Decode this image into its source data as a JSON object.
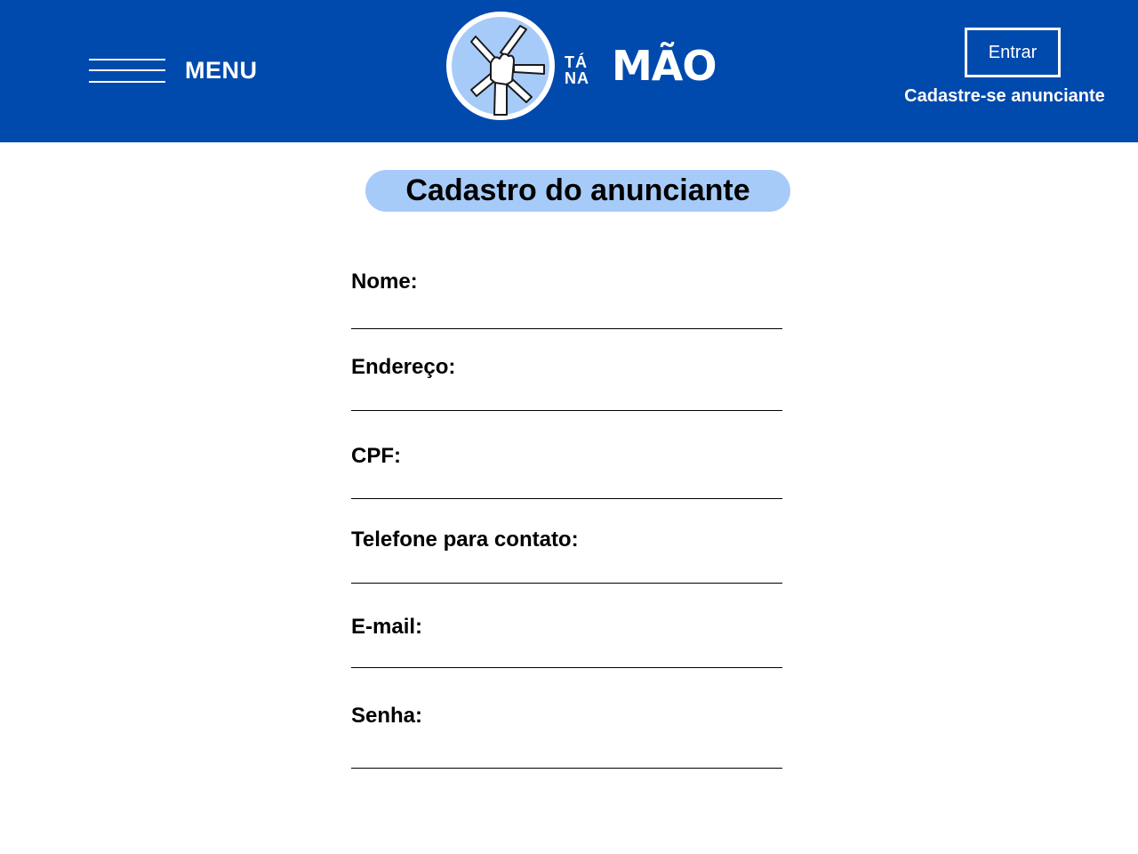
{
  "header": {
    "menu_label": "MENU",
    "logo": {
      "small_top": "TÁ",
      "small_bottom": "NA",
      "big": "MÃO"
    },
    "login_label": "Entrar",
    "signup_label": "Cadastre-se anunciante"
  },
  "colors": {
    "header_bg": "#004aad",
    "title_pill_bg": "#a7cbf9",
    "logo_circle": "#a7cbf9"
  },
  "form": {
    "title": "Cadastro do anunciante",
    "fields": [
      {
        "label": "Nome:",
        "value": ""
      },
      {
        "label": "Endereço:",
        "value": ""
      },
      {
        "label": "CPF:",
        "value": ""
      },
      {
        "label": "Telefone para contato:",
        "value": ""
      },
      {
        "label": "E-mail:",
        "value": ""
      },
      {
        "label": "Senha:",
        "value": ""
      }
    ]
  },
  "icons": [
    "menu-hamburger-icon",
    "hands-together-logo-icon"
  ]
}
